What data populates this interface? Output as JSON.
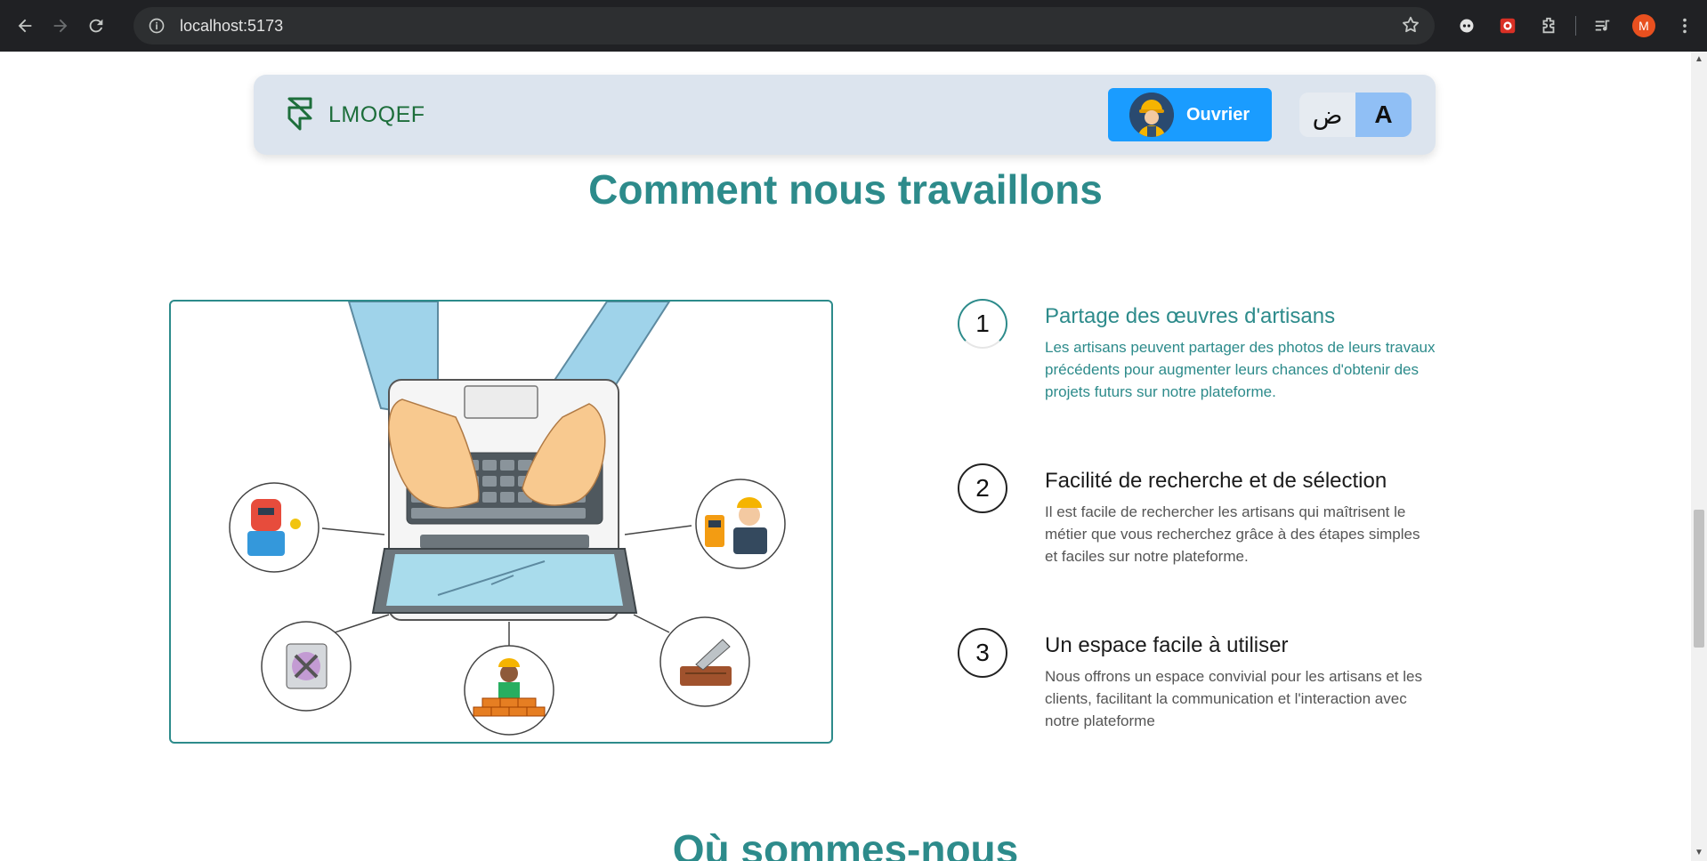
{
  "browser": {
    "url": "localhost:5173",
    "profile_initial": "M"
  },
  "navbar": {
    "logo_text": "LMOQEF",
    "role_button": "Ouvrier",
    "lang_ar": "ض",
    "lang_fr": "A"
  },
  "how_we_work": {
    "title": "Comment nous travaillons",
    "steps": [
      {
        "number": "1",
        "title": "Partage des œuvres d'artisans",
        "description": "Les artisans peuvent partager des photos de leurs travaux précédents pour augmenter leurs chances d'obtenir des projets futurs sur notre plateforme."
      },
      {
        "number": "2",
        "title": "Facilité de recherche et de sélection",
        "description": "Il est facile de rechercher les artisans qui maîtrisent le métier que vous recherchez grâce à des étapes simples et faciles sur notre plateforme."
      },
      {
        "number": "3",
        "title": "Un espace facile à utiliser",
        "description": "Nous offrons un espace convivial pour les artisans et les clients, facilitant la communication et l'interaction avec notre plateforme"
      }
    ]
  },
  "where_we_are": {
    "title": "Où sommes-nous"
  },
  "colors": {
    "accent": "#2d8b8b",
    "button": "#1a9cff",
    "navbar_bg": "#dce4ee"
  }
}
